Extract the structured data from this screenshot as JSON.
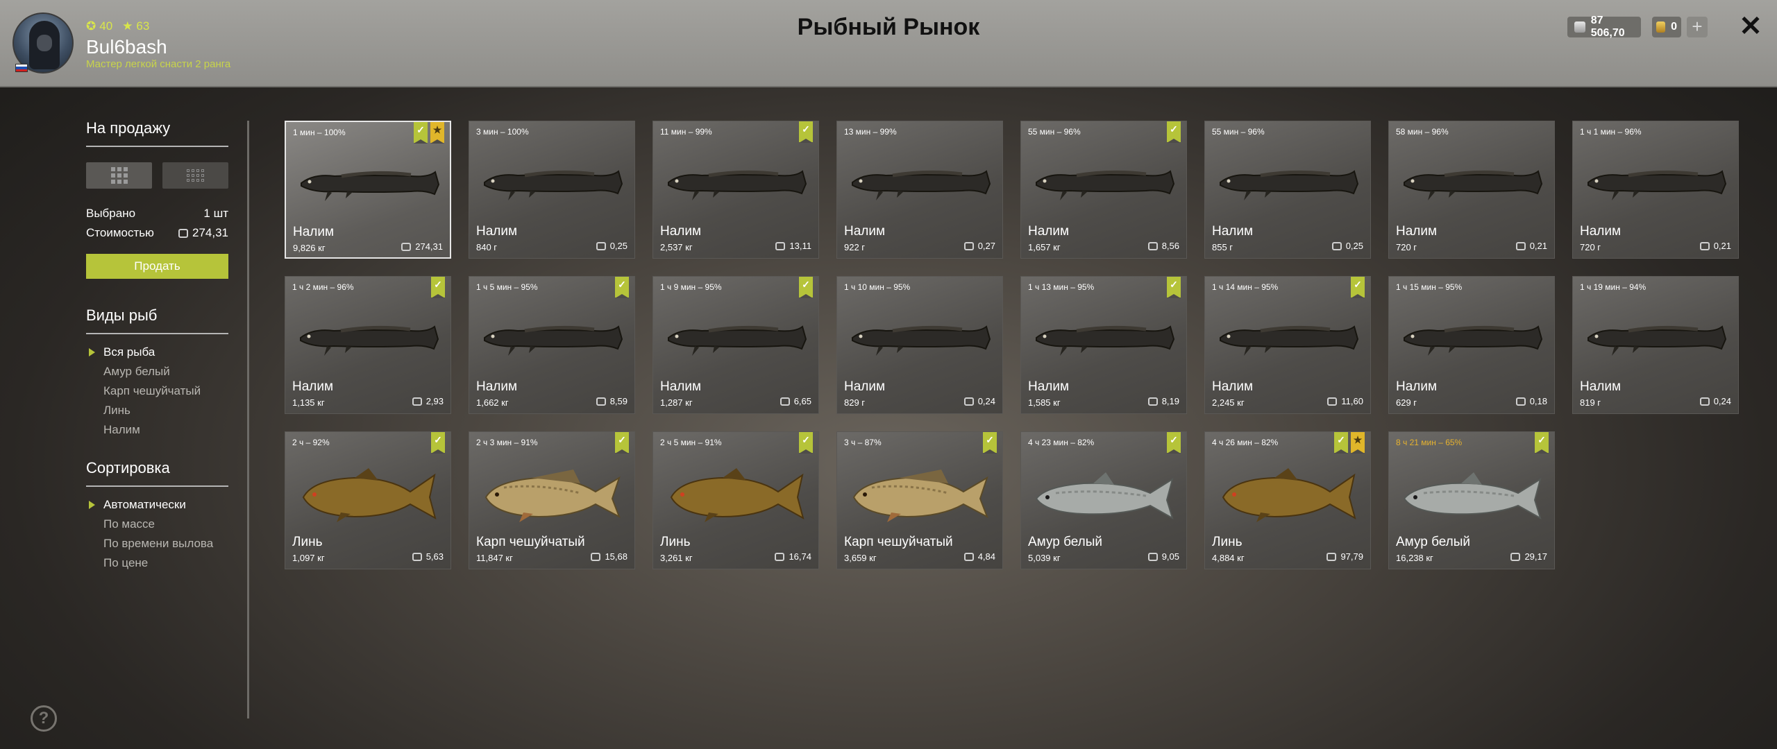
{
  "header": {
    "title": "Рыбный Рынок",
    "username": "Bul6bash",
    "rank": "Мастер легкой снасти 2 ранга",
    "level": "40",
    "stars": "63",
    "silver": "87 506,70",
    "gold": "0",
    "add_label": "+",
    "close_label": "✕"
  },
  "sidebar": {
    "for_sale_title": "На продажу",
    "selected_label": "Выбрано",
    "selected_value": "1 шт",
    "cost_label": "Стоимостью",
    "cost_value": "274,31",
    "sell_label": "Продать",
    "species_title": "Виды рыб",
    "species": [
      "Вся рыба",
      "Амур белый",
      "Карп чешуйчатый",
      "Линь",
      "Налим"
    ],
    "sort_title": "Сортировка",
    "sort_options": [
      "Автоматически",
      "По массе",
      "По времени вылова",
      "По цене"
    ],
    "help_label": "?"
  },
  "colors": {
    "accent": "#b6c43a",
    "star": "#e0b62a",
    "warning_time": "#e6b22e",
    "header_bg": "#9a9995"
  },
  "fish": [
    {
      "time": "1 мин – 100%",
      "name": "Налим",
      "weight": "9,826 кг",
      "price": "274,31",
      "check": true,
      "star": true,
      "kind": "burbot",
      "selected": true,
      "warn": false
    },
    {
      "time": "3 мин – 100%",
      "name": "Налим",
      "weight": "840 г",
      "price": "0,25",
      "check": false,
      "star": false,
      "kind": "burbot",
      "selected": false,
      "warn": false
    },
    {
      "time": "11 мин – 99%",
      "name": "Налим",
      "weight": "2,537 кг",
      "price": "13,11",
      "check": true,
      "star": false,
      "kind": "burbot",
      "selected": false,
      "warn": false
    },
    {
      "time": "13 мин – 99%",
      "name": "Налим",
      "weight": "922 г",
      "price": "0,27",
      "check": false,
      "star": false,
      "kind": "burbot",
      "selected": false,
      "warn": false
    },
    {
      "time": "55 мин – 96%",
      "name": "Налим",
      "weight": "1,657 кг",
      "price": "8,56",
      "check": true,
      "star": false,
      "kind": "burbot",
      "selected": false,
      "warn": false
    },
    {
      "time": "55 мин – 96%",
      "name": "Налим",
      "weight": "855 г",
      "price": "0,25",
      "check": false,
      "star": false,
      "kind": "burbot",
      "selected": false,
      "warn": false
    },
    {
      "time": "58 мин – 96%",
      "name": "Налим",
      "weight": "720 г",
      "price": "0,21",
      "check": false,
      "star": false,
      "kind": "burbot",
      "selected": false,
      "warn": false
    },
    {
      "time": "1 ч 1 мин – 96%",
      "name": "Налим",
      "weight": "720 г",
      "price": "0,21",
      "check": false,
      "star": false,
      "kind": "burbot",
      "selected": false,
      "warn": false
    },
    {
      "time": "1 ч 2 мин – 96%",
      "name": "Налим",
      "weight": "1,135 кг",
      "price": "2,93",
      "check": true,
      "star": false,
      "kind": "burbot",
      "selected": false,
      "warn": false
    },
    {
      "time": "1 ч 5 мин – 95%",
      "name": "Налим",
      "weight": "1,662 кг",
      "price": "8,59",
      "check": true,
      "star": false,
      "kind": "burbot",
      "selected": false,
      "warn": false
    },
    {
      "time": "1 ч 9 мин – 95%",
      "name": "Налим",
      "weight": "1,287 кг",
      "price": "6,65",
      "check": true,
      "star": false,
      "kind": "burbot",
      "selected": false,
      "warn": false
    },
    {
      "time": "1 ч 10 мин – 95%",
      "name": "Налим",
      "weight": "829 г",
      "price": "0,24",
      "check": false,
      "star": false,
      "kind": "burbot",
      "selected": false,
      "warn": false
    },
    {
      "time": "1 ч 13 мин – 95%",
      "name": "Налим",
      "weight": "1,585 кг",
      "price": "8,19",
      "check": true,
      "star": false,
      "kind": "burbot",
      "selected": false,
      "warn": false
    },
    {
      "time": "1 ч 14 мин – 95%",
      "name": "Налим",
      "weight": "2,245 кг",
      "price": "11,60",
      "check": true,
      "star": false,
      "kind": "burbot",
      "selected": false,
      "warn": false
    },
    {
      "time": "1 ч 15 мин – 95%",
      "name": "Налим",
      "weight": "629 г",
      "price": "0,18",
      "check": false,
      "star": false,
      "kind": "burbot",
      "selected": false,
      "warn": false
    },
    {
      "time": "1 ч 19 мин – 94%",
      "name": "Налим",
      "weight": "819 г",
      "price": "0,24",
      "check": false,
      "star": false,
      "kind": "burbot",
      "selected": false,
      "warn": false
    },
    {
      "time": "2 ч – 92%",
      "name": "Линь",
      "weight": "1,097 кг",
      "price": "5,63",
      "check": true,
      "star": false,
      "kind": "tench",
      "selected": false,
      "warn": false
    },
    {
      "time": "2 ч 3 мин – 91%",
      "name": "Карп чешуйчатый",
      "weight": "11,847 кг",
      "price": "15,68",
      "check": true,
      "star": false,
      "kind": "carp",
      "selected": false,
      "warn": false
    },
    {
      "time": "2 ч 5 мин – 91%",
      "name": "Линь",
      "weight": "3,261 кг",
      "price": "16,74",
      "check": true,
      "star": false,
      "kind": "tench",
      "selected": false,
      "warn": false
    },
    {
      "time": "3 ч – 87%",
      "name": "Карп чешуйчатый",
      "weight": "3,659 кг",
      "price": "4,84",
      "check": true,
      "star": false,
      "kind": "carp",
      "selected": false,
      "warn": false
    },
    {
      "time": "4 ч 23 мин – 82%",
      "name": "Амур белый",
      "weight": "5,039 кг",
      "price": "9,05",
      "check": true,
      "star": false,
      "kind": "amur",
      "selected": false,
      "warn": false
    },
    {
      "time": "4 ч 26 мин – 82%",
      "name": "Линь",
      "weight": "4,884 кг",
      "price": "97,79",
      "check": true,
      "star": true,
      "kind": "tench",
      "selected": false,
      "warn": false
    },
    {
      "time": "8 ч 21 мин – 65%",
      "name": "Амур белый",
      "weight": "16,238 кг",
      "price": "29,17",
      "check": true,
      "star": false,
      "kind": "amur",
      "selected": false,
      "warn": true
    }
  ]
}
